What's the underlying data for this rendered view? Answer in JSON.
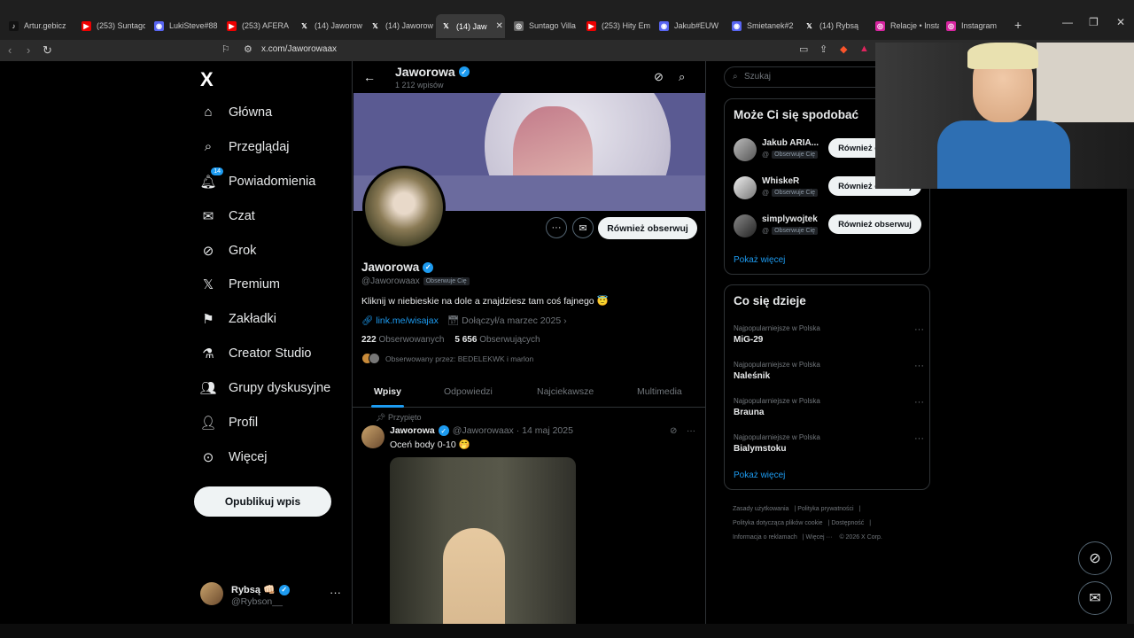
{
  "browser": {
    "tabs": [
      {
        "label": "Artur.gebicz",
        "icon": "tiktok-icon",
        "active": false
      },
      {
        "label": "(253) Suntago",
        "icon": "youtube-icon",
        "active": false
      },
      {
        "label": "LukiSteve#88",
        "icon": "discord-icon",
        "active": false
      },
      {
        "label": "(253) AFERA",
        "icon": "youtube-icon",
        "active": false
      },
      {
        "label": "(14) Jaworow",
        "icon": "x-icon",
        "active": false
      },
      {
        "label": "(14) Jaworow",
        "icon": "x-icon",
        "active": false
      },
      {
        "label": "(14) Jaw",
        "icon": "x-icon",
        "active": true
      },
      {
        "label": "Suntago Villa",
        "icon": "web-icon",
        "active": false
      },
      {
        "label": "(253) Hity Em",
        "icon": "youtube-icon",
        "active": false
      },
      {
        "label": "Jakub#EUW",
        "icon": "discord-icon",
        "active": false
      },
      {
        "label": "Smietanek#2",
        "icon": "discord-icon",
        "active": false
      },
      {
        "label": "(14) Rybsą",
        "icon": "x-icon",
        "active": false
      },
      {
        "label": "Relacje • Insta",
        "icon": "instagram-icon",
        "active": false
      },
      {
        "label": "Instagram",
        "icon": "instagram-icon",
        "active": false
      }
    ],
    "new_tab": "+",
    "url": "x.com/Jaworowaax"
  },
  "nav": {
    "logo": "X",
    "items": [
      {
        "label": "Główna",
        "icon": "home-icon"
      },
      {
        "label": "Przeglądaj",
        "icon": "search-icon"
      },
      {
        "label": "Powiadomienia",
        "icon": "bell-icon",
        "badge": "14"
      },
      {
        "label": "Czat",
        "icon": "mail-icon"
      },
      {
        "label": "Grok",
        "icon": "grok-icon"
      },
      {
        "label": "Premium",
        "icon": "x-logo-icon"
      },
      {
        "label": "Zakładki",
        "icon": "bookmark-icon"
      },
      {
        "label": "Creator Studio",
        "icon": "flask-icon"
      },
      {
        "label": "Grupy dyskusyjne",
        "icon": "group-icon"
      },
      {
        "label": "Profil",
        "icon": "person-icon"
      },
      {
        "label": "Więcej",
        "icon": "more-circle-icon"
      }
    ],
    "post_button": "Opublikuj wpis",
    "me": {
      "name": "Rybsą 👊🏻",
      "handle": "@Rybson__"
    }
  },
  "profile": {
    "header_name": "Jaworowa",
    "header_posts": "1 212 wpisów",
    "name": "Jaworowa",
    "handle": "@Jaworowaax",
    "follows_you": "Obserwuje Cię",
    "follow_button": "Również obserwuj",
    "bio": "Kliknij w niebieskie na dole a znajdziesz tam coś fajnego 😇",
    "link": "link.me/wisajax",
    "joined": "Dołączył/a marzec 2025",
    "following_count": "222",
    "following_label": "Obserwowanych",
    "followers_count": "5 656",
    "followers_label": "Obserwujących",
    "followed_by": "Obserwowany przez: BEDELEKWK i marlon",
    "tabs": [
      "Wpisy",
      "Odpowiedzi",
      "Najciekawsze",
      "Multimedia"
    ],
    "active_tab": "Wpisy"
  },
  "tweet": {
    "pinned": "Przypięto",
    "author": "Jaworowa",
    "handle_date": "@Jaworowaax · 14 maj 2025",
    "text": "Oceń body 0-10 🤭"
  },
  "sidebar": {
    "search_placeholder": "Szukaj",
    "who_to_follow": {
      "title": "Może Ci się spodobać",
      "users": [
        {
          "name": "Jakub ARIA...",
          "tag": "Obserwuje Cię",
          "button": "Również obserwuj"
        },
        {
          "name": "WhiskeR",
          "tag": "Obserwuje Cię",
          "button": "Również obserwuj"
        },
        {
          "name": "simplywojtek",
          "tag": "Obserwuje Cię",
          "button": "Również obserwuj"
        }
      ],
      "show_more": "Pokaż więcej"
    },
    "trends": {
      "title": "Co się dzieje",
      "items": [
        {
          "context": "Najpopularniejsze w Polska",
          "topic": "MiG-29"
        },
        {
          "context": "Najpopularniejsze w Polska",
          "topic": "Naleśnik"
        },
        {
          "context": "Najpopularniejsze w Polska",
          "topic": "Brauna"
        },
        {
          "context": "Najpopularniejsze w Polska",
          "topic": "Bialymstoku"
        }
      ],
      "show_more": "Pokaż więcej"
    },
    "footer": [
      "Zasady użytkowania",
      "Polityka prywatności",
      "Polityka dotycząca plików cookie",
      "Dostępność",
      "Informacja o reklamach",
      "Więcej ···",
      "© 2026 X Corp."
    ]
  },
  "colors": {
    "accent": "#1d9bf0",
    "background": "#000000",
    "text": "#e7e9ea",
    "muted": "#71767b"
  }
}
